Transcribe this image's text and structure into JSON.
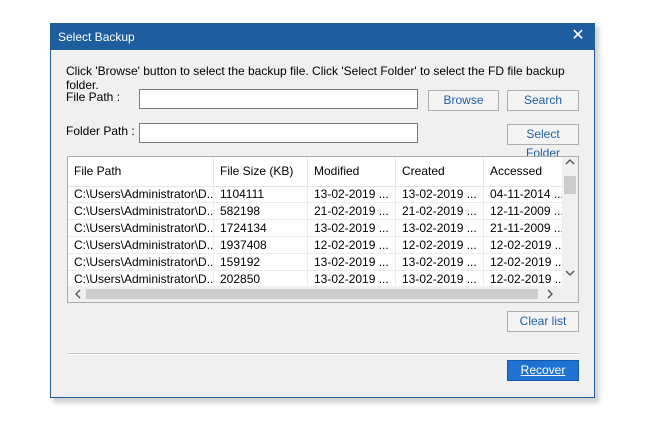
{
  "dialog": {
    "title": "Select Backup",
    "close_glyph": "✕",
    "instruction": "Click 'Browse' button to select the backup file. Click 'Select Folder' to select the FD file backup folder.",
    "file_path_label": "File Path :",
    "file_path_value": "",
    "folder_path_label": "Folder Path :",
    "folder_path_value": "",
    "browse_label": "Browse",
    "search_label": "Search",
    "select_folder_label": "Select Folder",
    "clear_list_label": "Clear list",
    "recover_label": "Recover"
  },
  "table": {
    "columns": [
      "File Path",
      "File Size (KB)",
      "Modified",
      "Created",
      "Accessed"
    ],
    "rows": [
      [
        "C:\\Users\\Administrator\\D...",
        "1104111",
        "13-02-2019 ...",
        "13-02-2019 ...",
        "04-11-2014 ..."
      ],
      [
        "C:\\Users\\Administrator\\D...",
        "582198",
        "21-02-2019 ...",
        "21-02-2019 ...",
        "12-11-2009 ..."
      ],
      [
        "C:\\Users\\Administrator\\D...",
        "1724134",
        "13-02-2019 ...",
        "13-02-2019 ...",
        "21-11-2009 ..."
      ],
      [
        "C:\\Users\\Administrator\\D...",
        "1937408",
        "12-02-2019 ...",
        "12-02-2019 ...",
        "12-02-2019 ..."
      ],
      [
        "C:\\Users\\Administrator\\D...",
        "159192",
        "13-02-2019 ...",
        "13-02-2019 ...",
        "12-02-2019 ..."
      ],
      [
        "C:\\Users\\Administrator\\D...",
        "202850",
        "13-02-2019 ...",
        "13-02-2019 ...",
        "12-02-2019 ..."
      ]
    ]
  },
  "icons": {
    "scroll_up": "chevron-up-icon",
    "scroll_down": "chevron-down-icon",
    "scroll_left": "chevron-left-icon",
    "scroll_right": "chevron-right-icon",
    "close": "close-icon"
  },
  "colors": {
    "titlebar": "#1e5d9e",
    "link_text": "#1f5fa8",
    "primary_button": "#1e73d2"
  }
}
